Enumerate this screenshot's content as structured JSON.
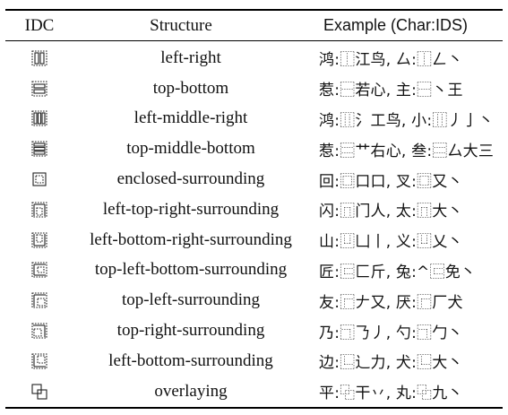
{
  "header": {
    "col_idc": "IDC",
    "col_structure": "Structure",
    "col_example": "Example (Char:IDS)"
  },
  "rows": [
    {
      "icon": "left-right-idc-icon",
      "structure": "left-right",
      "example": "鸿:⿰江鸟, 厶:⿰𠃋丶"
    },
    {
      "icon": "top-bottom-idc-icon",
      "structure": "top-bottom",
      "example": "惹:⿱若心, 主:⿱丶王"
    },
    {
      "icon": "left-middle-right-idc-icon",
      "structure": "left-middle-right",
      "example": "鸿:⿲氵工鸟, 小:⿲丿亅丶"
    },
    {
      "icon": "top-middle-bottom-idc-icon",
      "structure": "top-middle-bottom",
      "example": "惹:⿳艹右心, 叁:⿳厶大三"
    },
    {
      "icon": "enclosed-surrounding-idc-icon",
      "structure": "enclosed-surrounding",
      "example": "回:⿴口口, 叉:⿴又丶"
    },
    {
      "icon": "left-top-right-surrounding-idc-icon",
      "structure": "left-top-right-surrounding",
      "example": "闪:⿵门人, 太:⿵大丶"
    },
    {
      "icon": "left-bottom-right-surrounding-idc-icon",
      "structure": "left-bottom-right-surrounding",
      "example": "山:⿶凵丨, 义:⿶乂丶"
    },
    {
      "icon": "top-left-bottom-surrounding-idc-icon",
      "structure": "top-left-bottom-surrounding",
      "example": "匠:⿷匚斤, 兔:^⿷免丶"
    },
    {
      "icon": "top-left-surrounding-idc-icon",
      "structure": "top-left-surrounding",
      "example": "友:⿸𠂇又, 厌:⿸厂犬"
    },
    {
      "icon": "top-right-surrounding-idc-icon",
      "structure": "top-right-surrounding",
      "example": "乃:⿹𠄎丿, 勺:⿹勹丶"
    },
    {
      "icon": "left-bottom-surrounding-idc-icon",
      "structure": "left-bottom-surrounding",
      "example": "边:⿺辶力, 犬:⿺大丶"
    },
    {
      "icon": "overlaying-idc-icon",
      "structure": "overlaying",
      "example": "平:⿻干丷, 丸:⿻九丶"
    }
  ]
}
